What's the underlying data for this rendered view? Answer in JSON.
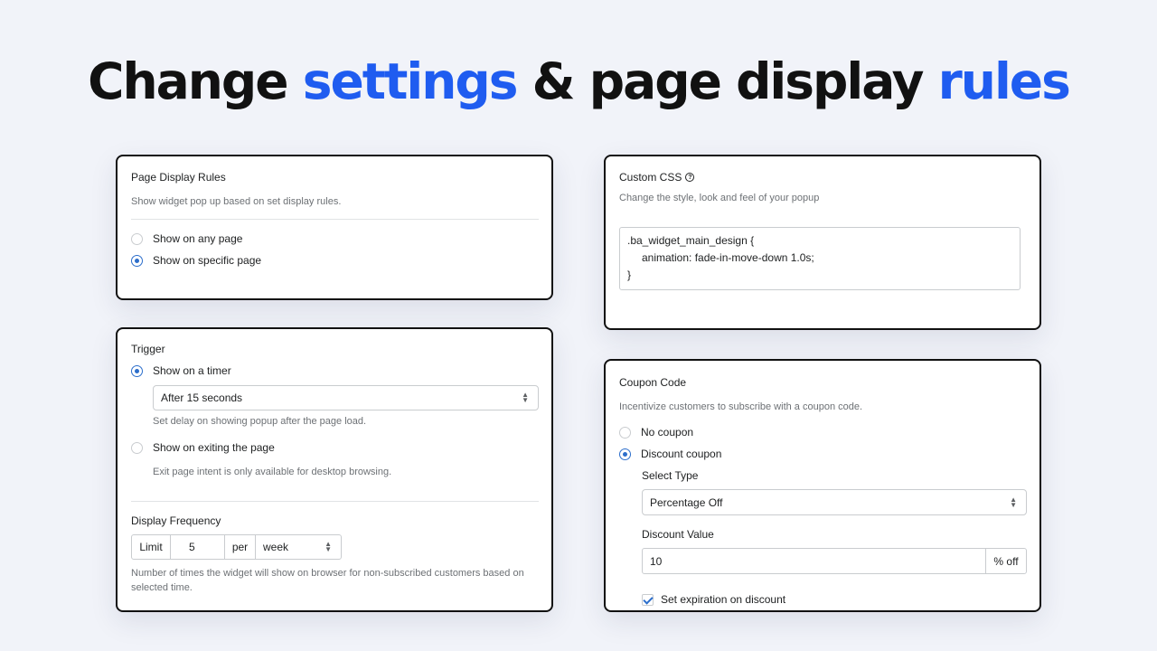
{
  "headline": {
    "part1": "Change ",
    "part2": "settings",
    "part3": " & page display ",
    "part4": "rules"
  },
  "colors": {
    "accent": "#1f5cf0",
    "radio_active": "#2c6ecb"
  },
  "page_display": {
    "title": "Page Display Rules",
    "subtitle": "Show widget pop up based on set display rules.",
    "options": [
      {
        "label": "Show on any page",
        "selected": false
      },
      {
        "label": "Show on specific page",
        "selected": true
      }
    ]
  },
  "trigger": {
    "title": "Trigger",
    "timer_label": "Show on a timer",
    "timer_value": "After 15 seconds",
    "timer_help": "Set delay on showing popup after the page load.",
    "exit_label": "Show on exiting the page",
    "exit_help": "Exit page intent is only available for desktop browsing.",
    "frequency_title": "Display Frequency",
    "limit_label": "Limit",
    "limit_value": "5",
    "per_label": "per",
    "period_value": "week",
    "frequency_help": "Number of times the widget will show on browser for non-subscribed customers based on selected time."
  },
  "custom_css": {
    "title": "Custom CSS",
    "help_icon": "question-circle-icon",
    "subtitle": "Change the style, look and feel of your popup",
    "code_lines": [
      ".ba_widget_main_design {",
      "animation: fade-in-move-down 1.0s;",
      "}"
    ]
  },
  "coupon": {
    "title": "Coupon Code",
    "subtitle": "Incentivize customers to subscribe with a coupon code.",
    "no_coupon_label": "No coupon",
    "discount_coupon_label": "Discount coupon",
    "select_type_label": "Select Type",
    "select_type_value": "Percentage Off",
    "discount_value_label": "Discount Value",
    "discount_value": "10",
    "discount_suffix": "% off",
    "expiration_label": "Set expiration on discount"
  }
}
